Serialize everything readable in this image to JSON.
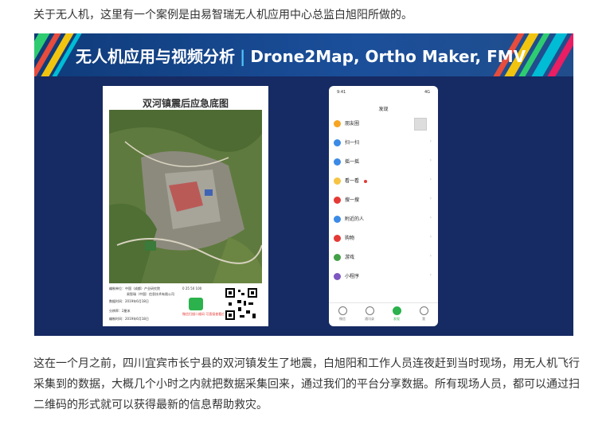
{
  "article": {
    "intro": "关于无人机，这里有一个案例是由易智瑞无人机应用中心总监白旭阳所做的。",
    "paragraph": "这在一个月之前，四川宜宾市长宁县的双河镇发生了地震，白旭阳和工作人员连夜赶到当时现场，用无人机飞行采集到的数据，大概几个小时之内就把数据采集回来，通过我们的平台分享数据。所有现场人员，都可以通过扫二维码的形式就可以获得最新的信息帮助救灾。"
  },
  "slide": {
    "title_cn": "无人机应用与视频分析",
    "title_sep": "|",
    "title_en": "Drone2Map, Ortho Maker, FMV",
    "poster": {
      "title": "双河镇震后应急底图",
      "info": [
        "编制单位：中国（成都）产业研究院",
        "易智瑞（中国）信息技术有限公司",
        "数据时间：2019年6月18日",
        "分辨率：2厘米",
        "编制时间：2019年6月18日"
      ],
      "scale": "0 25 50 100",
      "note": "微信扫描二维码 可直接查看应急底图"
    },
    "phone": {
      "status_time": "9:41",
      "status_right": "4G",
      "title": "发现",
      "items": [
        {
          "label": "朋友圈",
          "icon": "moments-icon",
          "color": "#f6a623"
        },
        {
          "label": "扫一扫",
          "icon": "scan-icon",
          "color": "#3b8ae6"
        },
        {
          "label": "摇一摇",
          "icon": "shake-icon",
          "color": "#3b8ae6"
        },
        {
          "label": "看一看",
          "icon": "look-icon",
          "color": "#f6c343"
        },
        {
          "label": "搜一搜",
          "icon": "search-icon",
          "color": "#e53935"
        },
        {
          "label": "附近的人",
          "icon": "nearby-icon",
          "color": "#3b8ae6"
        },
        {
          "label": "购物",
          "icon": "shop-icon",
          "color": "#e53935"
        },
        {
          "label": "游戏",
          "icon": "game-icon",
          "color": "#43a047"
        },
        {
          "label": "小程序",
          "icon": "miniprogram-icon",
          "color": "#7e57c2"
        }
      ],
      "tabs": [
        {
          "label": "微信",
          "icon": "chat-icon",
          "active": false
        },
        {
          "label": "通讯录",
          "icon": "contacts-icon",
          "active": false
        },
        {
          "label": "发现",
          "icon": "discover-icon",
          "active": true
        },
        {
          "label": "我",
          "icon": "me-icon",
          "active": false
        }
      ]
    }
  }
}
